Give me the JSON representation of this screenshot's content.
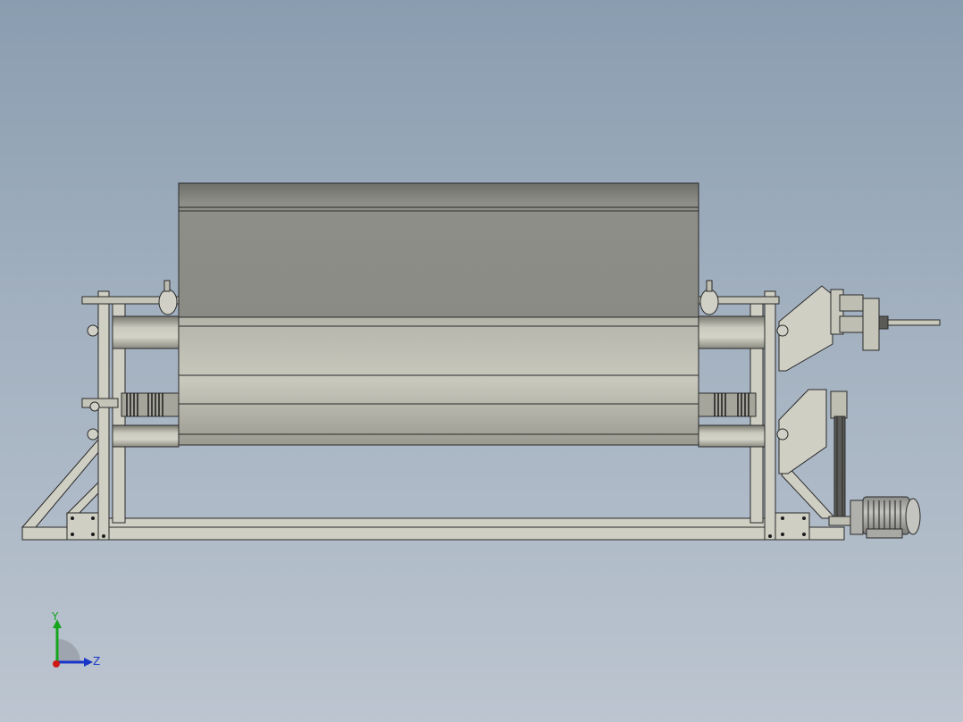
{
  "viewport": {
    "background_top": "#8a9db0",
    "background_bottom": "#bcc5d0"
  },
  "triad": {
    "y_label": "Y",
    "z_label": "Z",
    "y_color": "#14a51c",
    "z_color": "#1a35c8",
    "x_color": "#d01818"
  },
  "model": {
    "frame_color": "#cfcfc4",
    "edge_color": "#2a2a2a",
    "drum_color": "#8c8c86",
    "roller_color": "#bdbdb2",
    "motor_color": "#a0a09c"
  }
}
